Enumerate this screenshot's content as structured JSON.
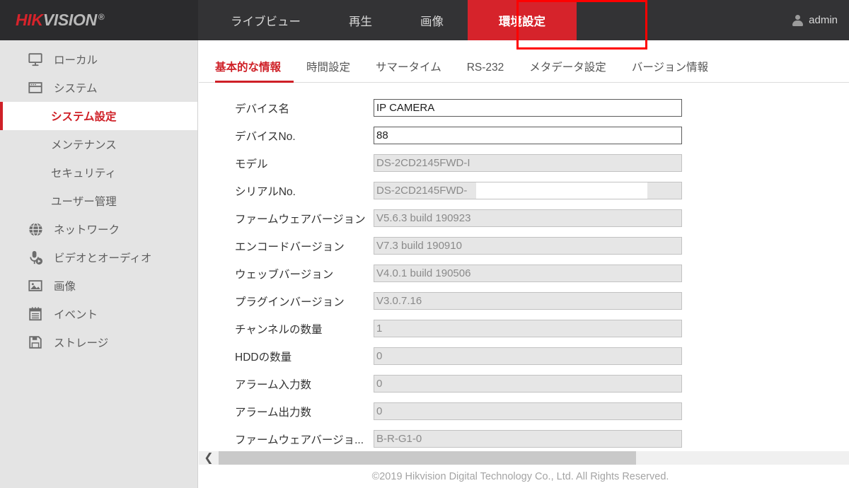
{
  "header": {
    "logo": {
      "part1": "HIK",
      "part2": "VISION",
      "reg": "®"
    },
    "nav": [
      {
        "label": "ライブビュー",
        "active": false
      },
      {
        "label": "再生",
        "active": false
      },
      {
        "label": "画像",
        "active": false
      },
      {
        "label": "環境設定",
        "active": true
      }
    ],
    "user": {
      "name": "admin",
      "icon": "user-icon"
    }
  },
  "sidebar": {
    "items": [
      {
        "label": "ローカル",
        "icon": "monitor-icon",
        "type": "top"
      },
      {
        "label": "システム",
        "icon": "window-icon",
        "type": "top"
      },
      {
        "label": "システム設定",
        "icon": "",
        "type": "sub",
        "active": true
      },
      {
        "label": "メンテナンス",
        "icon": "",
        "type": "sub",
        "active": false
      },
      {
        "label": "セキュリティ",
        "icon": "",
        "type": "sub",
        "active": false
      },
      {
        "label": "ユーザー管理",
        "icon": "",
        "type": "sub",
        "active": false
      },
      {
        "label": "ネットワーク",
        "icon": "globe-icon",
        "type": "top"
      },
      {
        "label": "ビデオとオーディオ",
        "icon": "microphone-icon",
        "type": "top"
      },
      {
        "label": "画像",
        "icon": "picture-icon",
        "type": "top"
      },
      {
        "label": "イベント",
        "icon": "calendar-icon",
        "type": "top"
      },
      {
        "label": "ストレージ",
        "icon": "floppy-disk-icon",
        "type": "top"
      }
    ]
  },
  "tabs": [
    {
      "label": "基本的な情報",
      "active": true
    },
    {
      "label": "時間設定",
      "active": false
    },
    {
      "label": "サマータイム",
      "active": false
    },
    {
      "label": "RS-232",
      "active": false
    },
    {
      "label": "メタデータ設定",
      "active": false
    },
    {
      "label": "バージョン情報",
      "active": false
    }
  ],
  "form": {
    "rows": [
      {
        "label": "デバイス名",
        "value": "IP CAMERA",
        "editable": true,
        "redacted": false
      },
      {
        "label": "デバイスNo.",
        "value": "88",
        "editable": true,
        "redacted": false
      },
      {
        "label": "モデル",
        "value": "DS-2CD2145FWD-I",
        "editable": false,
        "redacted": false
      },
      {
        "label": "シリアルNo.",
        "value": "DS-2CD2145FWD-",
        "editable": false,
        "redacted": true
      },
      {
        "label": "ファームウェアバージョン",
        "value": "V5.6.3 build 190923",
        "editable": false,
        "redacted": false
      },
      {
        "label": "エンコードバージョン",
        "value": "V7.3 build 190910",
        "editable": false,
        "redacted": false
      },
      {
        "label": "ウェッブバージョン",
        "value": "V4.0.1 build 190506",
        "editable": false,
        "redacted": false
      },
      {
        "label": "プラグインバージョン",
        "value": "V3.0.7.16",
        "editable": false,
        "redacted": false
      },
      {
        "label": "チャンネルの数量",
        "value": "1",
        "editable": false,
        "redacted": false
      },
      {
        "label": "HDDの数量",
        "value": "0",
        "editable": false,
        "redacted": false
      },
      {
        "label": "アラーム入力数",
        "value": "0",
        "editable": false,
        "redacted": false
      },
      {
        "label": "アラーム出力数",
        "value": "0",
        "editable": false,
        "redacted": false
      },
      {
        "label": "ファームウェアバージョ...",
        "value": "B-R-G1-0",
        "editable": false,
        "redacted": false
      }
    ]
  },
  "scrollbar": {
    "collapse_icon": "❮"
  },
  "footer": {
    "copyright": "©2019 Hikvision Digital Technology Co., Ltd. All Rights Reserved."
  },
  "colors": {
    "brand_red": "#d6232b",
    "active_red": "#cf2027",
    "header_bg": "#333335",
    "sidebar_bg": "#e4e4e4",
    "annotation_red": "#ff0000"
  }
}
